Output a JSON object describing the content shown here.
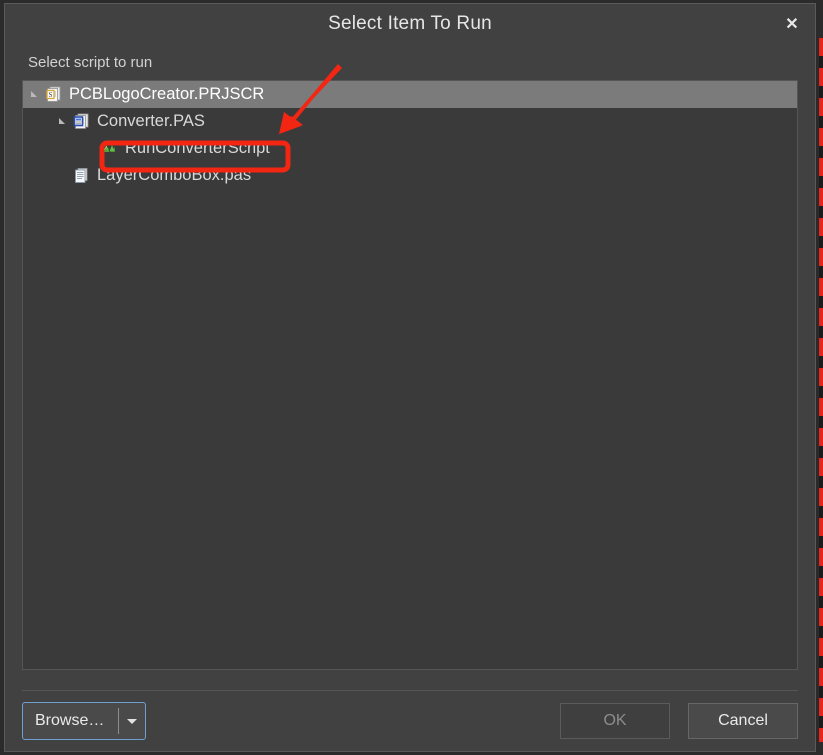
{
  "dialog": {
    "title": "Select Item To Run",
    "close_label": "✕",
    "close_icon": "close-icon"
  },
  "body": {
    "prompt": "Select script to run"
  },
  "tree": {
    "nodes": [
      {
        "label": "PCBLogoCreator.PRJSCR",
        "icon": "project-script-file-icon",
        "depth": 0,
        "expanded": true,
        "selected": true
      },
      {
        "label": "Converter.PAS",
        "icon": "pascal-script-file-icon",
        "depth": 1,
        "expanded": true,
        "selected": false
      },
      {
        "label": "RunConverterScript",
        "icon": "procedure-icon",
        "depth": 2,
        "expanded": false,
        "selected": false,
        "highlighted": true
      },
      {
        "label": "LayerComboBox.pas",
        "icon": "pascal-document-icon",
        "depth": 1,
        "expanded": false,
        "selected": false
      }
    ]
  },
  "footer": {
    "browse_label": "Browse…",
    "browse_dropdown_icon": "chevron-down-icon",
    "ok_label": "OK",
    "ok_enabled": false,
    "cancel_label": "Cancel"
  },
  "annotations": {
    "arrow_color": "#f22613",
    "highlight_box_color": "#f22613"
  },
  "colors": {
    "window_background": "#414141",
    "panel_background": "#3a3a3a",
    "selection": "#7b7b7b",
    "text": "#d9d9d9",
    "focus_border": "#6f9fd0",
    "accent_red": "#f22613"
  }
}
